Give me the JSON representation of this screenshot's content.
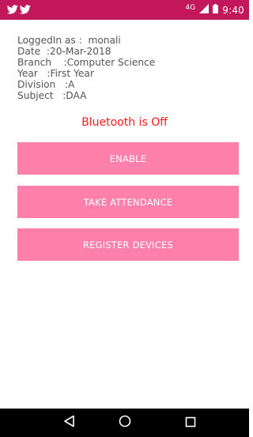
{
  "status_bar": {
    "notification_icons": [
      "twitter-icon",
      "twitter-icon"
    ],
    "network_type": "4G",
    "time": "9:40",
    "color": "#c2185b"
  },
  "session": {
    "lines": [
      "LoggedIn as :  monali",
      "Date  :20-Mar-2018",
      "Branch    :Computer Science",
      "Year   :First Year",
      "Division   :A",
      "Subject   :DAA"
    ]
  },
  "bluetooth": {
    "status_text": "Bluetooth is Off",
    "color": "#ff1a1a"
  },
  "buttons": {
    "enable_label": "ENABLE",
    "take_attendance_label": "TAKE ATTENDANCE",
    "register_devices_label": "REGISTER DEVICES",
    "color": "#ff80ab"
  },
  "nav_bar": {
    "icons": [
      "back-icon",
      "home-icon",
      "recents-icon"
    ]
  }
}
